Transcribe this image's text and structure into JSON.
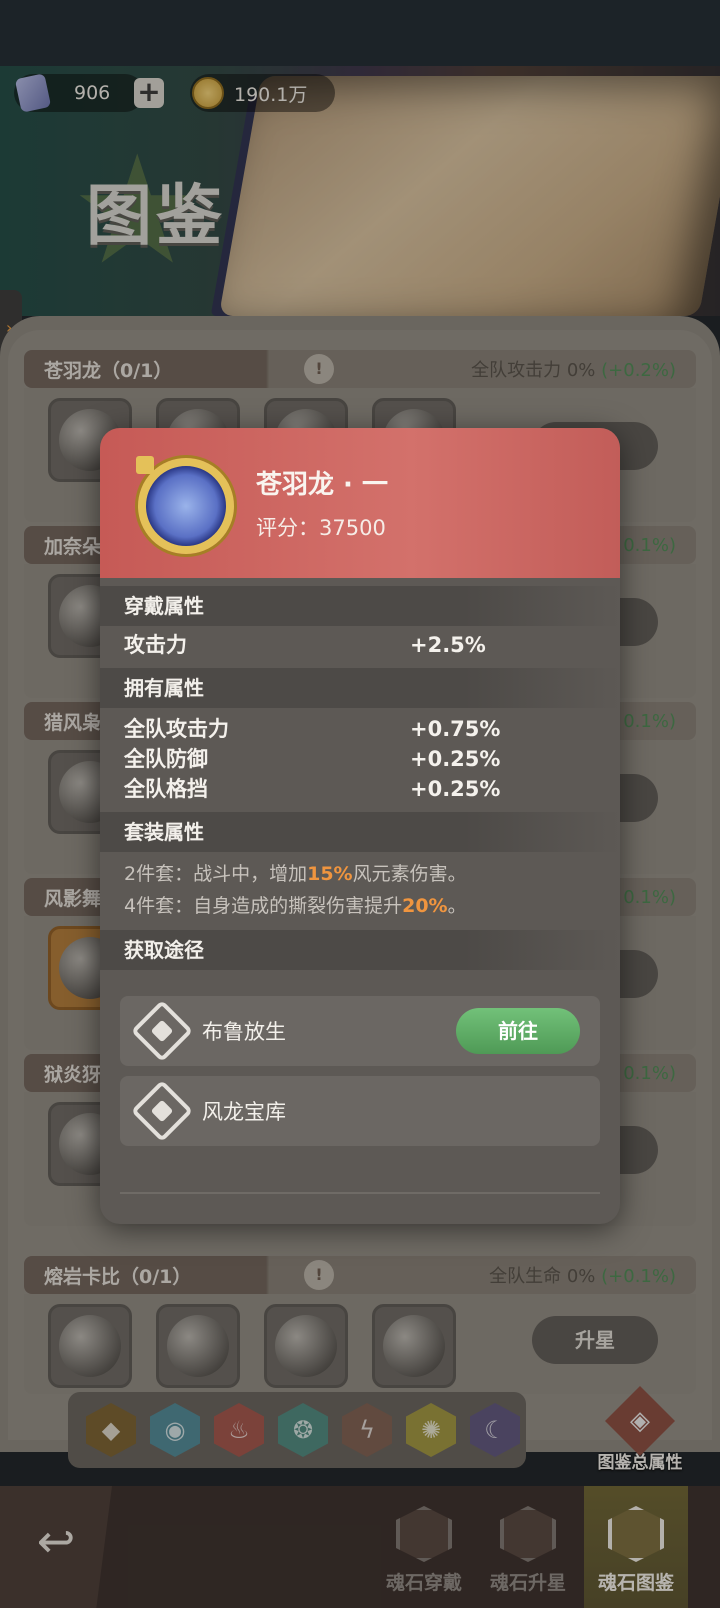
{
  "currency": {
    "gems": "906",
    "plus": "+",
    "coins": "190.1万"
  },
  "banner": {
    "title": "图鉴"
  },
  "groups": [
    {
      "name": "苍羽龙（0/1）",
      "bonus_text": "全队攻击力 0%",
      "bonus_plus": "(+0.2%)"
    },
    {
      "name": "加奈朵",
      "bonus_text": "",
      "bonus_plus": "0.1%)"
    },
    {
      "name": "猎风枭",
      "bonus_text": "",
      "bonus_plus": "0.1%)"
    },
    {
      "name": "风影舞",
      "bonus_text": "",
      "bonus_plus": "0.1%)"
    },
    {
      "name": "狱炎犽",
      "bonus_text": "",
      "bonus_plus": "0.1%)"
    },
    {
      "name": "熔岩卡比（0/1）",
      "bonus_text": "全队生命 0%",
      "bonus_plus": "(+0.1%)"
    }
  ],
  "warn_symbol": "!",
  "upgrade_label": "升星",
  "element_icons": [
    "earth-icon",
    "water-icon",
    "fire-icon",
    "wind-icon",
    "thunder-icon",
    "light-icon",
    "dark-icon"
  ],
  "total_attr_label": "图鉴总属性",
  "bottom_nav": {
    "back_label": "↩",
    "items": [
      {
        "label": "魂石穿戴"
      },
      {
        "label": "魂石升星"
      },
      {
        "label": "魂石图鉴"
      }
    ]
  },
  "detail": {
    "title": "苍羽龙 · 一",
    "score": "评分：37500",
    "wear_header": "穿戴属性",
    "wear_attrs": [
      {
        "name": "攻击力",
        "value": "+2.5%"
      }
    ],
    "own_header": "拥有属性",
    "own_attrs": [
      {
        "name": "全队攻击力",
        "value": "+0.75%"
      },
      {
        "name": "全队防御",
        "value": "+0.25%"
      },
      {
        "name": "全队格挡",
        "value": "+0.25%"
      }
    ],
    "set_header": "套装属性",
    "set2": {
      "prefix": "2件套：战斗中，增加",
      "highlight": "15%",
      "suffix": "风元素伤害。"
    },
    "set4": {
      "prefix": "4件套：自身造成的撕裂伤害提升",
      "highlight": "20%",
      "suffix": "。"
    },
    "source_header": "获取途径",
    "sources": [
      {
        "name": "布鲁放生",
        "button": "前往"
      },
      {
        "name": "风龙宝库"
      }
    ]
  },
  "colors": {
    "highlight": "#f0953f",
    "go_button": "#5fae66",
    "card_header": "#c9625e"
  }
}
